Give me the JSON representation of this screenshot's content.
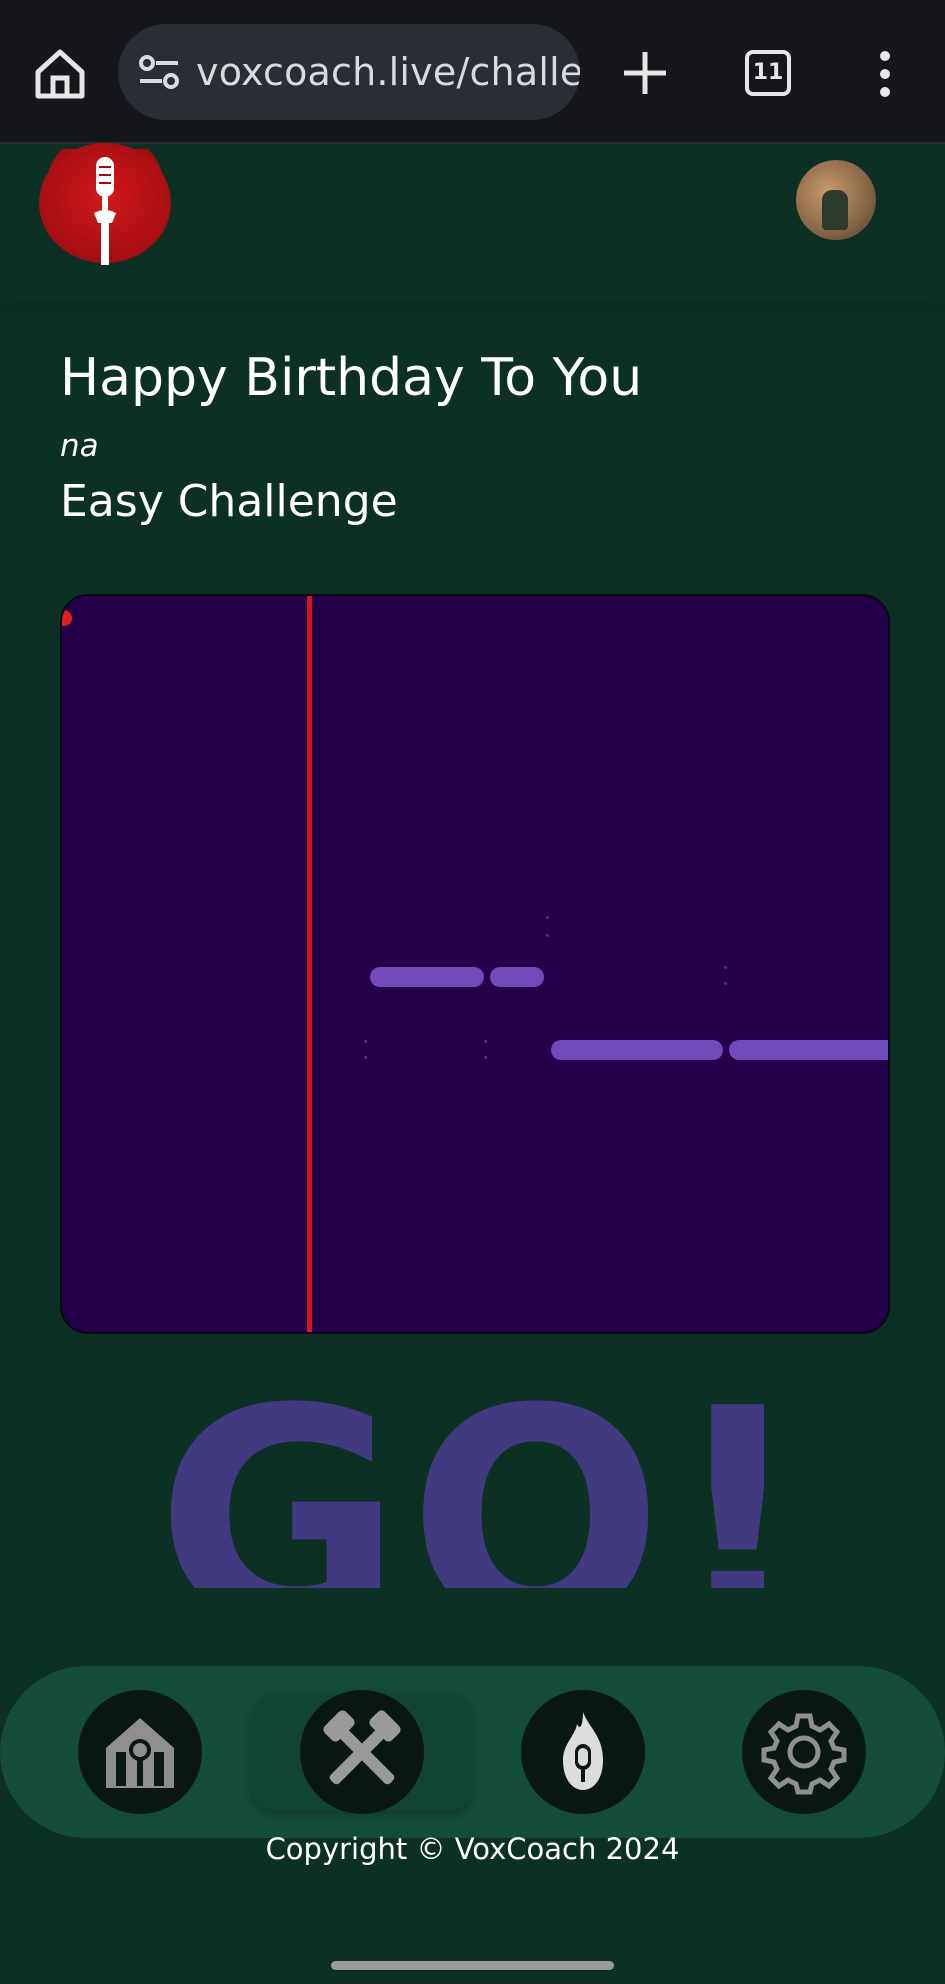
{
  "browser": {
    "url": "voxcoach.live/challen",
    "tab_count": "11",
    "icons": [
      "home-icon",
      "tune-icon",
      "plus-icon",
      "tabs-icon",
      "more-vert-icon"
    ]
  },
  "header": {
    "logo": "microphone-logo",
    "avatar": "user-avatar"
  },
  "song": {
    "title": "Happy Birthday To You",
    "by_line": "na",
    "level": "Easy Challenge"
  },
  "go_banner": "GO!",
  "nav": {
    "items": [
      "home-icon",
      "crossed-hammers-icon",
      "flame-mic-icon",
      "gear-icon"
    ],
    "active_index": 1
  },
  "footer": {
    "copyright": "Copyright © VoxCoach 2024"
  },
  "colors": {
    "page_bg": "#0c3023",
    "canvas_bg": "#24004a",
    "playhead": "#d7141e",
    "note": "#6f4ab8",
    "nav_bg": "#134c38",
    "go_text": "#423a80"
  }
}
